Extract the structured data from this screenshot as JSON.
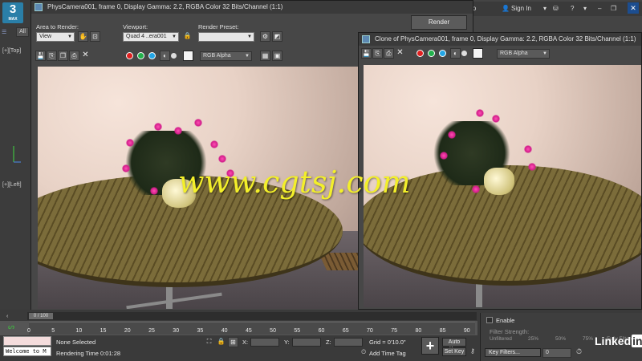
{
  "app": {
    "logo_text": "3",
    "logo_sub": "MAX",
    "tab_all": "All",
    "viewport_top_label": "[+][Top]",
    "viewport_left_label": "[+][Left]",
    "sign_in": "Sign In",
    "help_fragment": "lp",
    "close_glyph": "✕"
  },
  "render_frame": {
    "title": "PhysCamera001, frame 0, Display Gamma: 2.2, RGBA Color 32 Bits/Channel (1:1)",
    "area_label": "Area to Render:",
    "area_value": "View",
    "viewport_label": "Viewport:",
    "viewport_value": "Quad 4 ..era001",
    "preset_label": "Render Preset:",
    "preset_value": "",
    "render_button": "Render",
    "channel_value": "RGB Alpha"
  },
  "clone_frame": {
    "title": "Clone of PhysCamera001, frame 0, Display Gamma: 2.2, RGBA Color 32 Bits/Channel (1:1)",
    "channel_value": "RGB Alpha"
  },
  "timeline": {
    "slider_label": "0 / 100",
    "ticks": [
      "0",
      "5",
      "10",
      "15",
      "20",
      "25",
      "30",
      "35",
      "40",
      "45",
      "50",
      "55",
      "60",
      "65",
      "70",
      "75",
      "80",
      "85",
      "90"
    ]
  },
  "status": {
    "welcome": "Welcome to M",
    "selection": "None Selected",
    "rendering_time": "Rendering Time  0:01:28",
    "x_label": "X:",
    "y_label": "Y:",
    "z_label": "Z:",
    "grid": "Grid = 0'10.0\"",
    "add_time_tag": "Add Time Tag",
    "auto_key": "Auto Key",
    "set_key": "Set Key",
    "key_filters": "Key Filters...",
    "key_value": "0"
  },
  "filter_panel": {
    "enable": "Enable",
    "filter_strength": "Filter Strength:",
    "unfiltered": "Unfiltered",
    "p25": "25%",
    "p50": "50%",
    "p75": "75%",
    "fully": "Fully Filtered"
  },
  "watermark": "www.cgtsj.com",
  "brand": "Linked",
  "brand_in": "in",
  "colors": {
    "red": "#e02020",
    "green": "#22b14c",
    "blue": "#23a6e6",
    "accent": "#2a7fa8",
    "watermark": "#f3ef2a"
  }
}
